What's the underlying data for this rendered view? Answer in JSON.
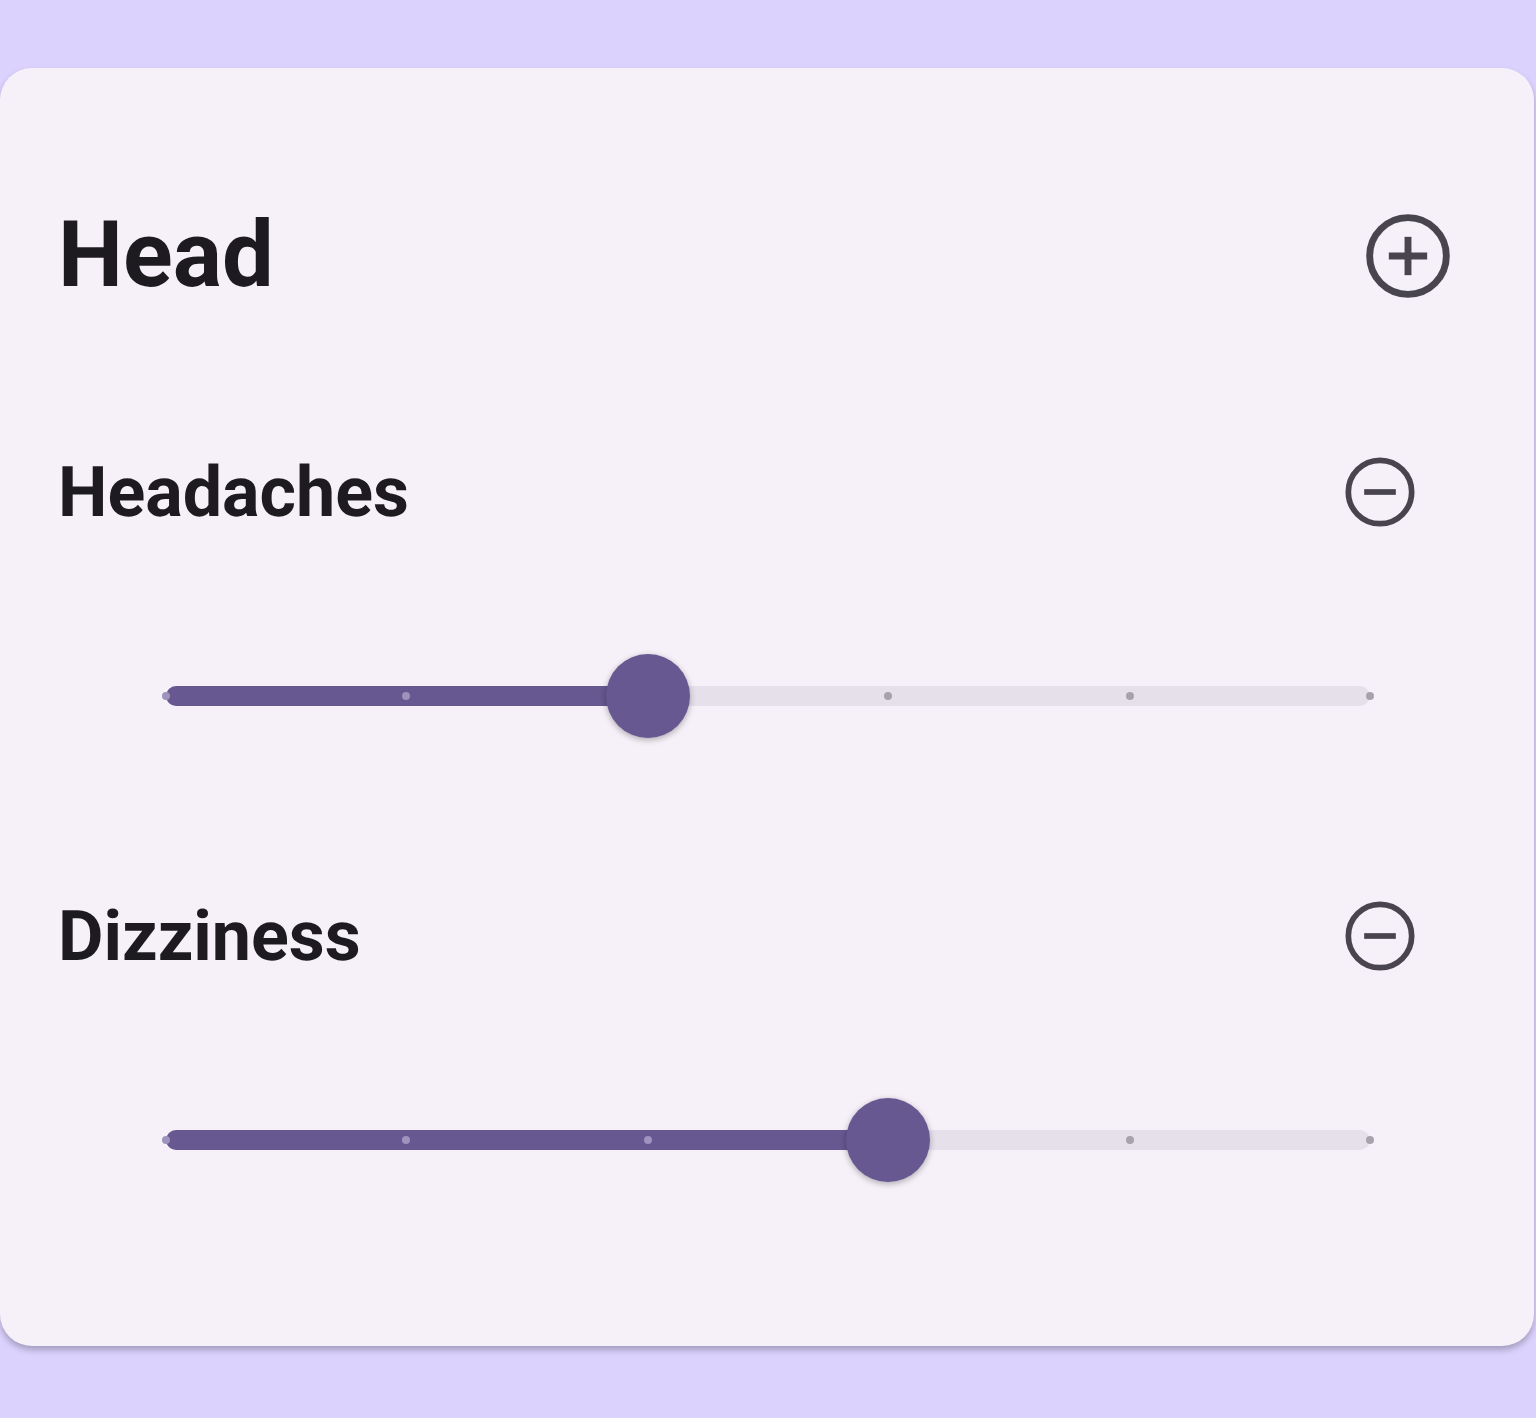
{
  "card": {
    "title": "Head",
    "symptoms": [
      {
        "name": "Headaches",
        "level": 0.4
      },
      {
        "name": "Dizziness",
        "level": 0.6
      }
    ]
  }
}
